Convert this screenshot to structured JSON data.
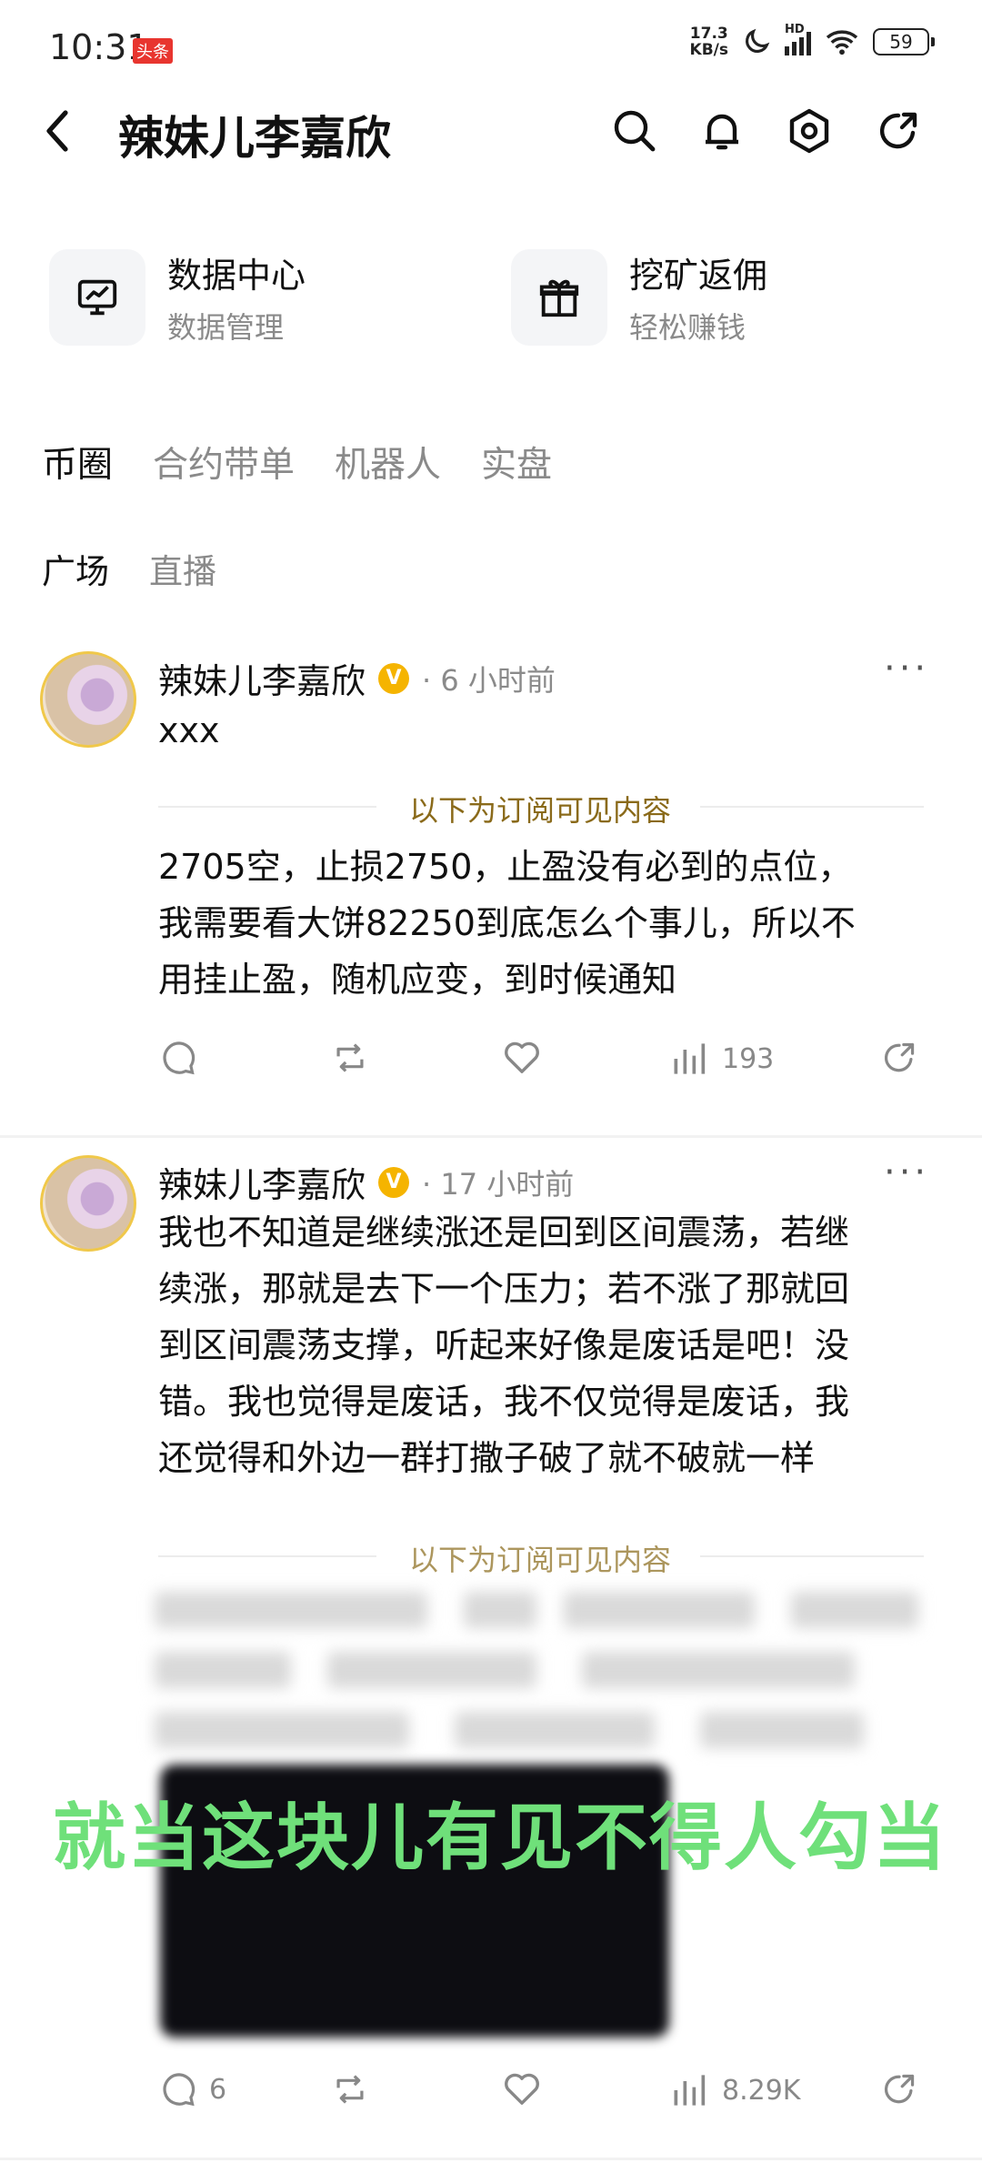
{
  "status": {
    "time": "10:31",
    "badge": "头条",
    "net_speed_top": "17.3",
    "net_speed_bottom": "KB/s",
    "battery": "59",
    "hd": "HD"
  },
  "header": {
    "title": "辣妹儿李嘉欣"
  },
  "shortcuts": [
    {
      "title": "数据中心",
      "subtitle": "数据管理",
      "icon": "chart-monitor-icon"
    },
    {
      "title": "挖矿返佣",
      "subtitle": "轻松赚钱",
      "icon": "gift-icon"
    }
  ],
  "tabs": [
    "币圈",
    "合约带单",
    "机器人",
    "实盘"
  ],
  "subtabs": [
    "广场",
    "直播"
  ],
  "posts": [
    {
      "author": "辣妹儿李嘉欣",
      "time": "6 小时前",
      "text": "xxx",
      "sub_label": "以下为订阅可见内容",
      "paid_lines": [
        "2705空，止损2750，止盈没有必到的点位，",
        "我需要看大饼82250到底怎么个事儿，所以不",
        "用挂止盈，随机应变，到时候通知"
      ],
      "views": "193",
      "comments": ""
    },
    {
      "author": "辣妹儿李嘉欣",
      "time": "17 小时前",
      "lines": [
        "我也不知道是继续涨还是回到区间震荡，若继",
        "续涨，那就是去下一个压力；若不涨了那就回",
        "到区间震荡支撑，听起来好像是废话是吧！没",
        "错。我也觉得是废话，我不仅觉得是废话，我",
        "还觉得和外边一群打撒子破了就不破就一样"
      ],
      "sub_label": "以下为订阅可见内容",
      "overlay": "就当这块儿有见不得人勾当",
      "views": "8.29K",
      "comments": "6"
    }
  ],
  "colors": {
    "accent_gold": "#f5b400",
    "overlay_green": "#6fe07a",
    "sub_label": "#8a6a1a"
  }
}
